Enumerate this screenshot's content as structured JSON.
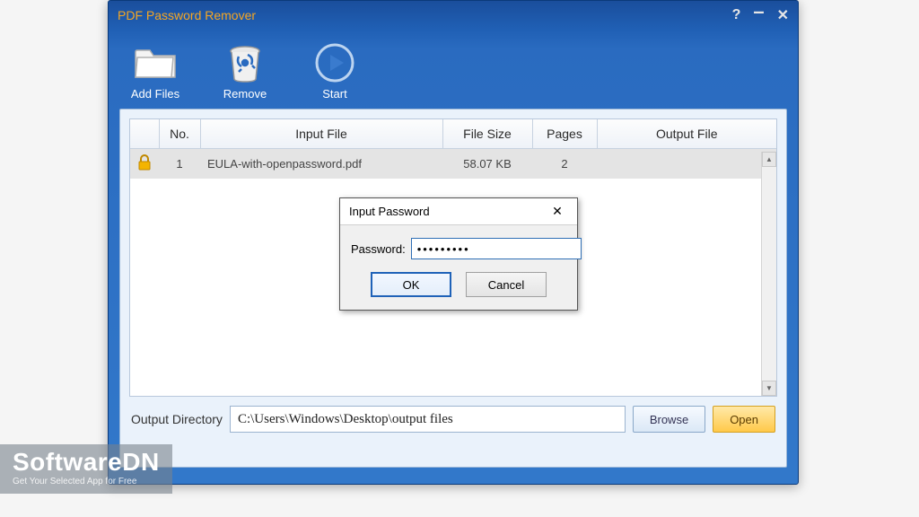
{
  "window": {
    "title": "PDF Password Remover"
  },
  "toolbar": {
    "add_files": "Add Files",
    "remove": "Remove",
    "start": "Start"
  },
  "table": {
    "headers": {
      "no": "No.",
      "input_file": "Input File",
      "file_size": "File Size",
      "pages": "Pages",
      "output_file": "Output File"
    },
    "rows": [
      {
        "no": "1",
        "input_file": "EULA-with-openpassword.pdf",
        "file_size": "58.07 KB",
        "pages": "2",
        "output_file": ""
      }
    ]
  },
  "output": {
    "label": "Output Directory",
    "path": "C:\\Users\\Windows\\Desktop\\output files",
    "browse": "Browse",
    "open": "Open"
  },
  "dialog": {
    "title": "Input Password",
    "label": "Password:",
    "value": "•••••••••",
    "ok": "OK",
    "cancel": "Cancel"
  },
  "watermark": {
    "name": "SoftwareDN",
    "tagline": "Get Your Selected App for Free"
  }
}
